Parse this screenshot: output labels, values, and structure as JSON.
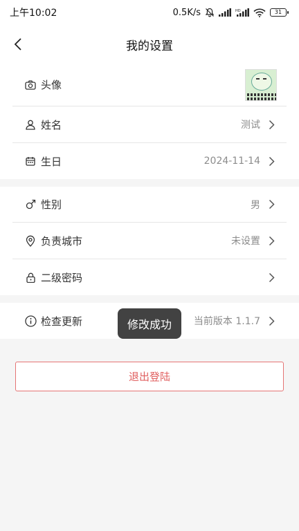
{
  "status_bar": {
    "time": "上午10:02",
    "net_speed": "0.5K/s",
    "battery": "31",
    "icons": [
      "mute-bell-icon",
      "signal-icon",
      "hd-signal-icon",
      "wifi-icon",
      "battery-icon"
    ]
  },
  "header": {
    "title": "我的设置",
    "back_icon": "chevron-left-icon"
  },
  "groups": [
    {
      "items": [
        {
          "label": "头像",
          "icon": "camera-icon",
          "value": "",
          "type": "avatar",
          "avatar_caption_line1": "有事请找我单独和",
          "avatar_caption_line2": "你 我亦谁谁谁啊"
        },
        {
          "label": "姓名",
          "icon": "user-icon",
          "value": "测试"
        },
        {
          "label": "生日",
          "icon": "calendar-icon",
          "value": "2024-11-14"
        }
      ]
    },
    {
      "items": [
        {
          "label": "性别",
          "icon": "male-icon",
          "value": "男"
        },
        {
          "label": "负责城市",
          "icon": "location-pin-icon",
          "value": "未设置"
        },
        {
          "label": "二级密码",
          "icon": "lock-icon",
          "value": ""
        }
      ]
    },
    {
      "items": [
        {
          "label": "检查更新",
          "icon": "info-icon",
          "value": "当前版本 1.1.7"
        }
      ]
    }
  ],
  "toast": {
    "text": "修改成功"
  },
  "logout": {
    "label": "退出登陆"
  },
  "colors": {
    "background": "#f5f5f5",
    "logout_accent": "#e06060",
    "toast_bg": "#323232"
  }
}
